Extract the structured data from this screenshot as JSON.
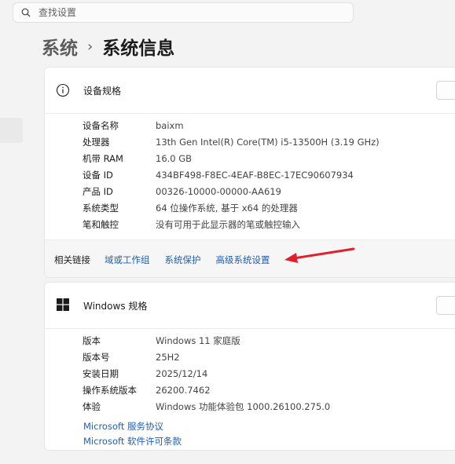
{
  "search": {
    "placeholder": "查找设置"
  },
  "breadcrumb": {
    "parent": "系统",
    "separator": "›",
    "current": "系统信息"
  },
  "device_specs": {
    "title": "设备规格",
    "rows": [
      {
        "label": "设备名称",
        "value": "baixm"
      },
      {
        "label": "处理器",
        "value": "13th Gen Intel(R) Core(TM) i5-13500H (3.19 GHz)"
      },
      {
        "label": "机带 RAM",
        "value": "16.0 GB"
      },
      {
        "label": "设备 ID",
        "value": "434BF498-F8EC-4EAF-B8EC-17EC90607934"
      },
      {
        "label": "产品 ID",
        "value": "00326-10000-00000-AA619"
      },
      {
        "label": "系统类型",
        "value": "64 位操作系统, 基于 x64 的处理器"
      },
      {
        "label": "笔和触控",
        "value": "没有可用于此显示器的笔或触控输入"
      }
    ],
    "related": {
      "label": "相关链接",
      "links": [
        "域或工作组",
        "系统保护",
        "高级系统设置"
      ]
    }
  },
  "windows_specs": {
    "title": "Windows 规格",
    "rows": [
      {
        "label": "版本",
        "value": "Windows 11 家庭版"
      },
      {
        "label": "版本号",
        "value": "25H2"
      },
      {
        "label": "安装日期",
        "value": "2025/12/14"
      },
      {
        "label": "操作系统版本",
        "value": "26200.7462"
      },
      {
        "label": "体验",
        "value": "Windows 功能体验包 1000.26100.275.0"
      }
    ],
    "links": [
      "Microsoft 服务协议",
      "Microsoft 软件许可条款"
    ]
  },
  "colors": {
    "link": "#1d5fbf",
    "annotation_arrow": "#e0202a",
    "background": "#f3f3f3"
  },
  "icons": {
    "search": "search-icon",
    "device_info": "info-icon",
    "windows": "windows-logo-icon"
  }
}
